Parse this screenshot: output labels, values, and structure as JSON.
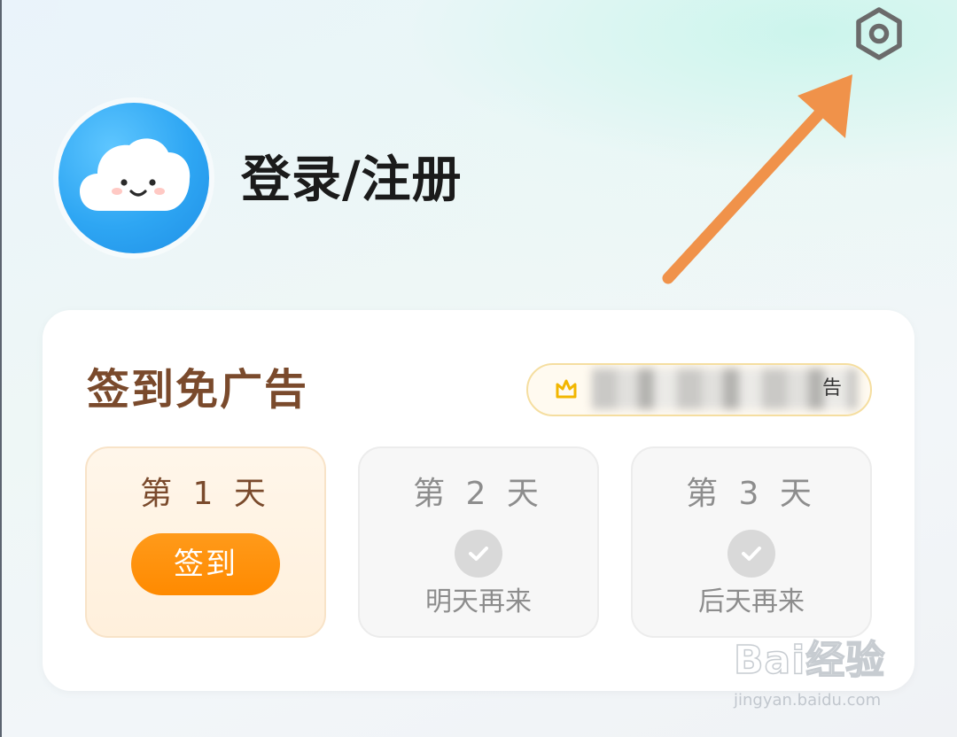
{
  "header": {
    "login_label": "登录/注册",
    "settings_icon": "settings-hexagon-icon",
    "avatar_icon": "cloud-mascot-icon"
  },
  "checkin_card": {
    "title": "签到免广告",
    "promo": {
      "icon": "crown-icon",
      "visible_tail": "告"
    },
    "days": [
      {
        "label": "第 1 天",
        "button_label": "签到",
        "state": "available"
      },
      {
        "label": "第 2 天",
        "note": "明天再来",
        "state": "pending"
      },
      {
        "label": "第 3 天",
        "note": "后天再来",
        "state": "pending"
      }
    ]
  },
  "watermark": {
    "logo_text": "Bai经验",
    "url": "jingyan.baidu.com"
  },
  "colors": {
    "accent_orange": "#ff8a00",
    "title_brown": "#7a4a2c",
    "annotation_arrow": "#f0924a",
    "avatar_blue": "#2ea6f3"
  }
}
